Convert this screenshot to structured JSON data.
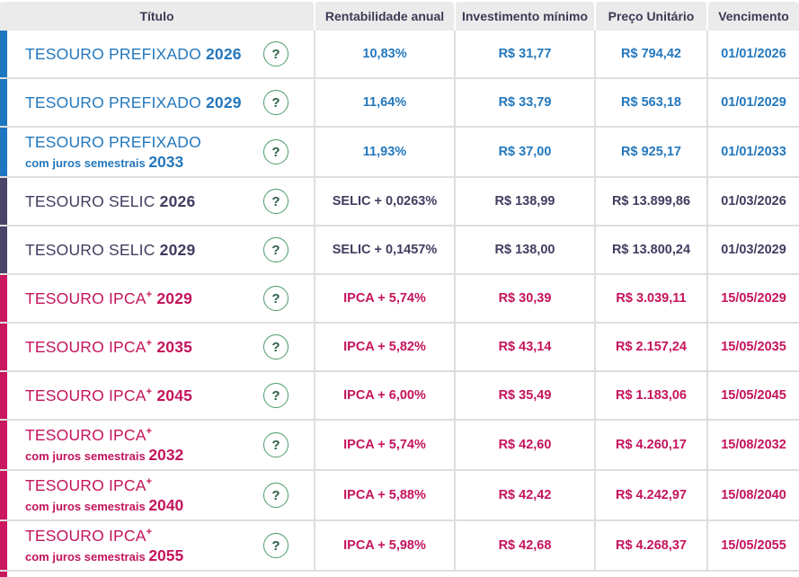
{
  "columns": {
    "titulo": "Título",
    "rentabilidade": "Rentabilidade anual",
    "investimento": "Investimento mínimo",
    "preco": "Preço Unitário",
    "vencimento": "Vencimento"
  },
  "icons": {
    "help": "?"
  },
  "themes": {
    "blue": {
      "bar": "#1d76c0",
      "text": "#2478bd"
    },
    "purple": {
      "bar": "#4a4568",
      "text": "#413d60"
    },
    "pink": {
      "bar": "#cb175f",
      "text": "#c4145c"
    }
  },
  "ui": {
    "header_bg": "#ebebeb",
    "header_text": "#3b3b55",
    "row_border": "#dedede",
    "icon_border": "#4d9b6b",
    "icon_glyph": "#2a5f45"
  },
  "chart_data": {
    "type": "table",
    "title": "Tesouro Direto - Títulos disponíveis",
    "columns": [
      "Título",
      "Rentabilidade anual",
      "Investimento mínimo",
      "Preço Unitário",
      "Vencimento"
    ],
    "rows": [
      [
        "TESOURO PREFIXADO 2026",
        "10,83%",
        "R$ 31,77",
        "R$ 794,42",
        "01/01/2026"
      ],
      [
        "TESOURO PREFIXADO 2029",
        "11,64%",
        "R$ 33,79",
        "R$ 563,18",
        "01/01/2029"
      ],
      [
        "TESOURO PREFIXADO com juros semestrais 2033",
        "11,93%",
        "R$ 37,00",
        "R$ 925,17",
        "01/01/2033"
      ],
      [
        "TESOURO SELIC 2026",
        "SELIC + 0,0263%",
        "R$ 138,99",
        "R$ 13.899,86",
        "01/03/2026"
      ],
      [
        "TESOURO SELIC 2029",
        "SELIC + 0,1457%",
        "R$ 138,00",
        "R$ 13.800,24",
        "01/03/2029"
      ],
      [
        "TESOURO IPCA+ 2029",
        "IPCA + 5,74%",
        "R$ 30,39",
        "R$ 3.039,11",
        "15/05/2029"
      ],
      [
        "TESOURO IPCA+ 2035",
        "IPCA + 5,82%",
        "R$ 43,14",
        "R$ 2.157,24",
        "15/05/2035"
      ],
      [
        "TESOURO IPCA+ 2045",
        "IPCA + 6,00%",
        "R$ 35,49",
        "R$ 1.183,06",
        "15/05/2045"
      ],
      [
        "TESOURO IPCA+ com juros semestrais 2032",
        "IPCA + 5,74%",
        "R$ 42,60",
        "R$ 4.260,17",
        "15/08/2032"
      ],
      [
        "TESOURO IPCA+ com juros semestrais 2040",
        "IPCA + 5,88%",
        "R$ 42,42",
        "R$ 4.242,97",
        "15/08/2040"
      ],
      [
        "TESOURO IPCA+ com juros semestrais 2055",
        "IPCA + 5,98%",
        "R$ 42,68",
        "R$ 4.268,37",
        "15/05/2055"
      ]
    ]
  },
  "rows": [
    {
      "theme": "blue",
      "name": "TESOURO PREFIXADO",
      "sup": "",
      "subtitle": "",
      "year": "2026",
      "rate": "10,83%",
      "min": "R$ 31,77",
      "price": "R$ 794,42",
      "maturity": "01/01/2026"
    },
    {
      "theme": "blue",
      "name": "TESOURO PREFIXADO",
      "sup": "",
      "subtitle": "",
      "year": "2029",
      "rate": "11,64%",
      "min": "R$ 33,79",
      "price": "R$ 563,18",
      "maturity": "01/01/2029"
    },
    {
      "theme": "blue",
      "name": "TESOURO PREFIXADO",
      "sup": "",
      "subtitle": "com juros semestrais",
      "year": "2033",
      "rate": "11,93%",
      "min": "R$ 37,00",
      "price": "R$ 925,17",
      "maturity": "01/01/2033"
    },
    {
      "theme": "purple",
      "name": "TESOURO SELIC",
      "sup": "",
      "subtitle": "",
      "year": "2026",
      "rate": "SELIC + 0,0263%",
      "min": "R$ 138,99",
      "price": "R$ 13.899,86",
      "maturity": "01/03/2026"
    },
    {
      "theme": "purple",
      "name": "TESOURO SELIC",
      "sup": "",
      "subtitle": "",
      "year": "2029",
      "rate": "SELIC + 0,1457%",
      "min": "R$ 138,00",
      "price": "R$ 13.800,24",
      "maturity": "01/03/2029"
    },
    {
      "theme": "pink",
      "name": "TESOURO IPCA",
      "sup": "+",
      "subtitle": "",
      "year": "2029",
      "rate": "IPCA + 5,74%",
      "min": "R$ 30,39",
      "price": "R$ 3.039,11",
      "maturity": "15/05/2029"
    },
    {
      "theme": "pink",
      "name": "TESOURO IPCA",
      "sup": "+",
      "subtitle": "",
      "year": "2035",
      "rate": "IPCA + 5,82%",
      "min": "R$ 43,14",
      "price": "R$ 2.157,24",
      "maturity": "15/05/2035"
    },
    {
      "theme": "pink",
      "name": "TESOURO IPCA",
      "sup": "+",
      "subtitle": "",
      "year": "2045",
      "rate": "IPCA + 6,00%",
      "min": "R$ 35,49",
      "price": "R$ 1.183,06",
      "maturity": "15/05/2045"
    },
    {
      "theme": "pink",
      "name": "TESOURO IPCA",
      "sup": "+",
      "subtitle": "com juros semestrais",
      "year": "2032",
      "rate": "IPCA + 5,74%",
      "min": "R$ 42,60",
      "price": "R$ 4.260,17",
      "maturity": "15/08/2032"
    },
    {
      "theme": "pink",
      "name": "TESOURO IPCA",
      "sup": "+",
      "subtitle": "com juros semestrais",
      "year": "2040",
      "rate": "IPCA + 5,88%",
      "min": "R$ 42,42",
      "price": "R$ 4.242,97",
      "maturity": "15/08/2040"
    },
    {
      "theme": "pink",
      "name": "TESOURO IPCA",
      "sup": "+",
      "subtitle": "com juros semestrais",
      "year": "2055",
      "rate": "IPCA + 5,98%",
      "min": "R$ 42,68",
      "price": "R$ 4.268,37",
      "maturity": "15/05/2055"
    }
  ],
  "partial_row": {
    "theme": "pink"
  }
}
